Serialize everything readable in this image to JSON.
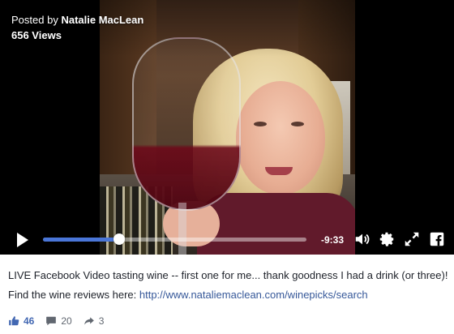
{
  "post": {
    "posted_by_prefix": "Posted by",
    "author": "Natalie MacLean",
    "views": "656 Views"
  },
  "player": {
    "progress_fraction": 0.29,
    "time_remaining": "-9:33",
    "accent_color": "#4a76d8",
    "icons": [
      "play-icon",
      "volume-icon",
      "settings-gear-icon",
      "fullscreen-icon",
      "facebook-icon"
    ]
  },
  "caption": {
    "line1": "LIVE Facebook Video tasting wine -- first one for me... thank goodness I had a drink (or three)!",
    "line2_prefix": "Find the wine reviews here:",
    "link": "http://www.nataliemaclean.com/winepicks/search"
  },
  "reactions": {
    "likes": "46",
    "comments": "20",
    "shares": "3"
  }
}
